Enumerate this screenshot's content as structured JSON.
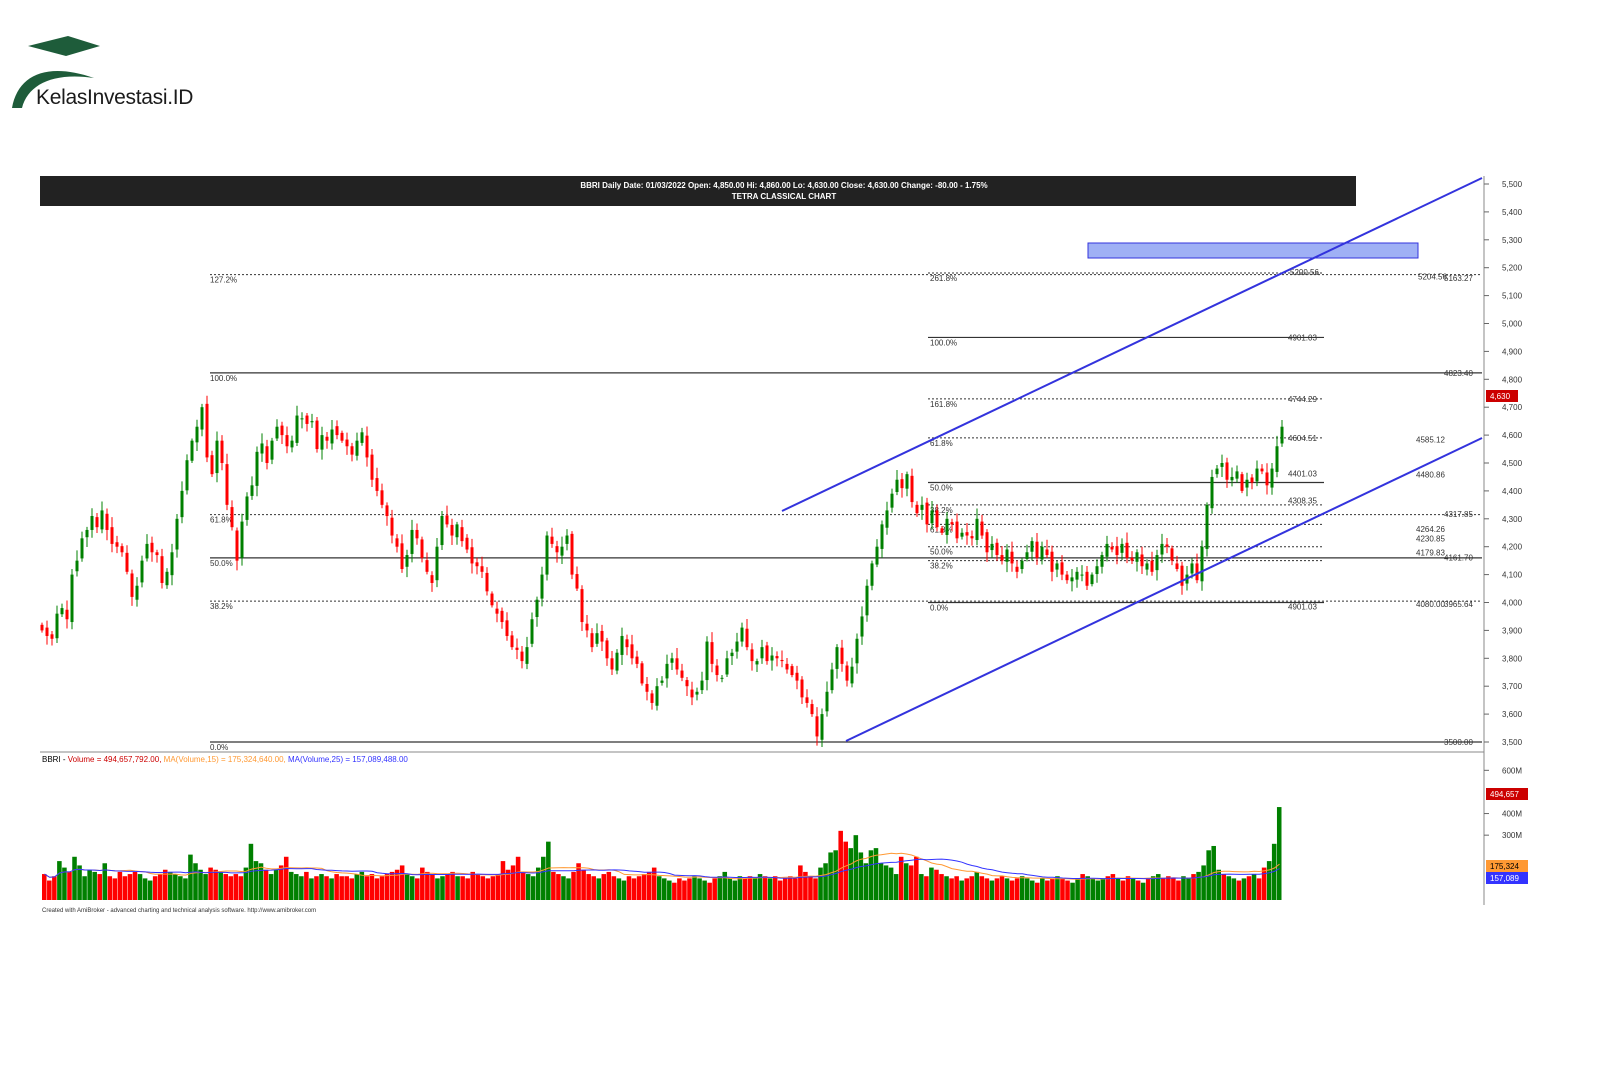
{
  "brand": {
    "logo_text": "KelasInvestasi.ID",
    "logo_color": "#1e5c3a"
  },
  "chart_header": {
    "line1": "BBRI Daily  Date: 01/03/2022  Open: 4,850.00  Hi: 4,860.00  Lo: 4,630.00  Close: 4,630.00  Change: -80.00 - 1.75%",
    "line2": "TETRA CLASSICAL CHART"
  },
  "volume_header": {
    "prefix": "BBRI - ",
    "volume": "Volume = 494,657,792.00,",
    "ma15": "MA(Volume,15) = 175,324,640.00,",
    "ma25": "MA(Volume,25) = 157,089,488.00"
  },
  "footer_text": "Created with AmiBroker - advanced charting and technical analysis software. http://www.amibroker.com",
  "colors": {
    "up": "#008000",
    "down": "#ff0000",
    "channel": "#3333dd",
    "fib": "#333333",
    "target_box": "#8a9ef0",
    "ma15": "#ff9933",
    "ma25": "#3333ff"
  },
  "chart_data": {
    "type": "candlestick",
    "title": "BBRI Daily",
    "subtitle": "TETRA CLASSICAL CHART",
    "ylim": [
      3500,
      5500
    ],
    "y_ticks": [
      "5,500",
      "5,400",
      "5,300",
      "5,200",
      "5,100",
      "5,000",
      "4,900",
      "4,800",
      "4,700",
      "4,600",
      "4,500",
      "4,400",
      "4,300",
      "4,200",
      "4,100",
      "4,000",
      "3,900",
      "3,800",
      "3,700",
      "3,600",
      "3,500"
    ],
    "last_close": 4630,
    "last_close_label": "4,630",
    "close_series": [
      3900,
      3880,
      3870,
      3960,
      3980,
      3940,
      4100,
      4150,
      4230,
      4260,
      4310,
      4270,
      4330,
      4260,
      4210,
      4200,
      4180,
      4110,
      4020,
      4060,
      4150,
      4210,
      4180,
      4170,
      4070,
      4110,
      4180,
      4300,
      4400,
      4510,
      4580,
      4630,
      4700,
      4520,
      4460,
      4580,
      4500,
      4350,
      4270,
      4150,
      4290,
      4380,
      4420,
      4540,
      4570,
      4500,
      4580,
      4630,
      4600,
      4560,
      4580,
      4670,
      4660,
      4640,
      4650,
      4550,
      4600,
      4580,
      4620,
      4600,
      4580,
      4560,
      4530,
      4580,
      4610,
      4520,
      4440,
      4400,
      4350,
      4310,
      4240,
      4200,
      4120,
      4170,
      4260,
      4230,
      4160,
      4110,
      4070,
      4200,
      4310,
      4280,
      4240,
      4280,
      4220,
      4190,
      4140,
      4130,
      4110,
      4040,
      3990,
      3960,
      3930,
      3880,
      3840,
      3830,
      3790,
      3840,
      3940,
      4010,
      4100,
      4240,
      4210,
      4180,
      4200,
      4240,
      4100,
      4050,
      3930,
      3900,
      3840,
      3890,
      3860,
      3800,
      3760,
      3820,
      3880,
      3840,
      3800,
      3780,
      3710,
      3680,
      3640,
      3700,
      3720,
      3780,
      3800,
      3760,
      3730,
      3700,
      3660,
      3680,
      3720,
      3860,
      3780,
      3740,
      3730,
      3800,
      3820,
      3860,
      3910,
      3840,
      3790,
      3790,
      3840,
      3790,
      3810,
      3800,
      3790,
      3760,
      3740,
      3720,
      3660,
      3640,
      3600,
      3520,
      3600,
      3680,
      3760,
      3840,
      3780,
      3720,
      3770,
      3870,
      3950,
      4060,
      4140,
      4200,
      4280,
      4330,
      4390,
      4440,
      4410,
      4460,
      4360,
      4320,
      4350,
      4280,
      4330,
      4270,
      4250,
      4300,
      4280,
      4230,
      4250,
      4240,
      4230,
      4300,
      4240,
      4180,
      4210,
      4170,
      4150,
      4190,
      4140,
      4110,
      4150,
      4180,
      4220,
      4160,
      4200,
      4170,
      4110,
      4140,
      4100,
      4080,
      4090,
      4110,
      4100,
      4060,
      4100,
      4130,
      4170,
      4210,
      4190,
      4170,
      4210,
      4160,
      4150,
      4180,
      4130,
      4140,
      4110,
      4170,
      4210,
      4200,
      4150,
      4120,
      4060,
      4100,
      4140,
      4080,
      4200,
      4350,
      4450,
      4480,
      4500,
      4440,
      4450,
      4470,
      4400,
      4440,
      4430,
      4480,
      4470,
      4420,
      4480,
      4560,
      4630
    ],
    "volume_m": [
      120,
      90,
      110,
      180,
      150,
      130,
      200,
      160,
      110,
      140,
      130,
      120,
      170,
      110,
      100,
      130,
      110,
      120,
      130,
      120,
      100,
      90,
      110,
      120,
      140,
      130,
      120,
      110,
      100,
      210,
      170,
      140,
      120,
      150,
      140,
      130,
      120,
      110,
      120,
      110,
      150,
      260,
      180,
      170,
      140,
      120,
      140,
      160,
      200,
      130,
      120,
      110,
      130,
      100,
      110,
      120,
      110,
      100,
      120,
      110,
      110,
      100,
      120,
      130,
      110,
      120,
      100,
      110,
      120,
      130,
      140,
      160,
      120,
      110,
      100,
      150,
      130,
      120,
      100,
      110,
      120,
      130,
      110,
      110,
      100,
      130,
      120,
      110,
      100,
      110,
      120,
      180,
      140,
      160,
      200,
      130,
      120,
      110,
      150,
      200,
      270,
      130,
      120,
      110,
      100,
      130,
      170,
      140,
      120,
      110,
      100,
      120,
      130,
      110,
      100,
      90,
      110,
      100,
      110,
      120,
      130,
      150,
      110,
      100,
      90,
      80,
      100,
      90,
      100,
      110,
      100,
      90,
      80,
      100,
      110,
      130,
      100,
      90,
      110,
      100,
      110,
      100,
      120,
      110,
      100,
      110,
      90,
      100,
      110,
      100,
      160,
      130,
      110,
      100,
      150,
      170,
      220,
      230,
      320,
      270,
      240,
      300,
      220,
      170,
      230,
      240,
      170,
      160,
      150,
      120,
      200,
      170,
      160,
      200,
      120,
      110,
      150,
      140,
      120,
      110,
      100,
      110,
      90,
      100,
      110,
      130,
      110,
      100,
      90,
      100,
      110,
      100,
      90,
      100,
      110,
      100,
      90,
      80,
      100,
      90,
      100,
      110,
      100,
      90,
      80,
      100,
      120,
      110,
      100,
      90,
      100,
      110,
      120,
      100,
      90,
      110,
      100,
      90,
      80,
      100,
      110,
      120,
      100,
      110,
      100,
      90,
      110,
      100,
      120,
      130,
      160,
      230,
      250,
      140,
      120,
      110,
      100,
      90,
      100,
      110,
      120,
      100,
      150,
      180,
      260,
      430
    ],
    "volume_ticks": [
      "600M",
      "400M",
      "300M"
    ],
    "volume_labels": {
      "current": "494,657",
      "ma15": "175,324",
      "ma25": "157,089"
    },
    "fib_sets": [
      {
        "levels": [
          {
            "pct": "127.2%",
            "price": 5175
          },
          {
            "pct": "100.0%",
            "price": 4823,
            "solid": true
          },
          {
            "pct": "61.8%",
            "price": 4315
          },
          {
            "pct": "50.0%",
            "price": 4160,
            "solid": true
          },
          {
            "pct": "38.2%",
            "price": 4005
          },
          {
            "pct": "0.0%",
            "price": 3500,
            "solid": true
          }
        ],
        "value_labels": [
          {
            "text": "4823.40",
            "price": 4823
          },
          {
            "text": "5163.27",
            "price": 5163
          },
          {
            "text": "3965.64",
            "price": 3995
          },
          {
            "text": "4161.70",
            "price": 4161
          },
          {
            "text": "4317.85",
            "price": 4317
          },
          {
            "text": "3500.00",
            "price": 3500
          }
        ]
      },
      {
        "levels": [
          {
            "pct": "261.8%",
            "price": 5181
          },
          {
            "pct": "100.0%",
            "price": 4950,
            "solid": true
          },
          {
            "pct": "161.8%",
            "price": 4730
          },
          {
            "pct": "61.8%",
            "price": 4590
          },
          {
            "pct": "50.0%",
            "price": 4430,
            "solid": true
          },
          {
            "pct": "38.2%",
            "price": 4350
          },
          {
            "pct": "61.8%",
            "price": 4280
          },
          {
            "pct": "50.0%",
            "price": 4200
          },
          {
            "pct": "38.2%",
            "price": 4150
          },
          {
            "pct": "0.0%",
            "price": 4000,
            "solid": true
          }
        ],
        "value_labels": [
          {
            "text": "4901.03",
            "price": 4950
          },
          {
            "text": "4744.29",
            "price": 4730
          },
          {
            "text": "4604.51",
            "price": 4590
          },
          {
            "text": "4585.12",
            "price": 4585
          },
          {
            "text": "4401.03",
            "price": 4463
          },
          {
            "text": "4480.86",
            "price": 4458
          },
          {
            "text": "4308.35",
            "price": 4365
          },
          {
            "text": "4264.26",
            "price": 4264
          },
          {
            "text": "4230.85",
            "price": 4230
          },
          {
            "text": "4179.83",
            "price": 4179
          },
          {
            "text": "4901.03",
            "price": 3985
          },
          {
            "text": "4080.00",
            "price": 3995
          },
          {
            "text": "5200.56",
            "price": 5185
          },
          {
            "text": "5204.56",
            "price": 5168
          }
        ]
      }
    ]
  }
}
